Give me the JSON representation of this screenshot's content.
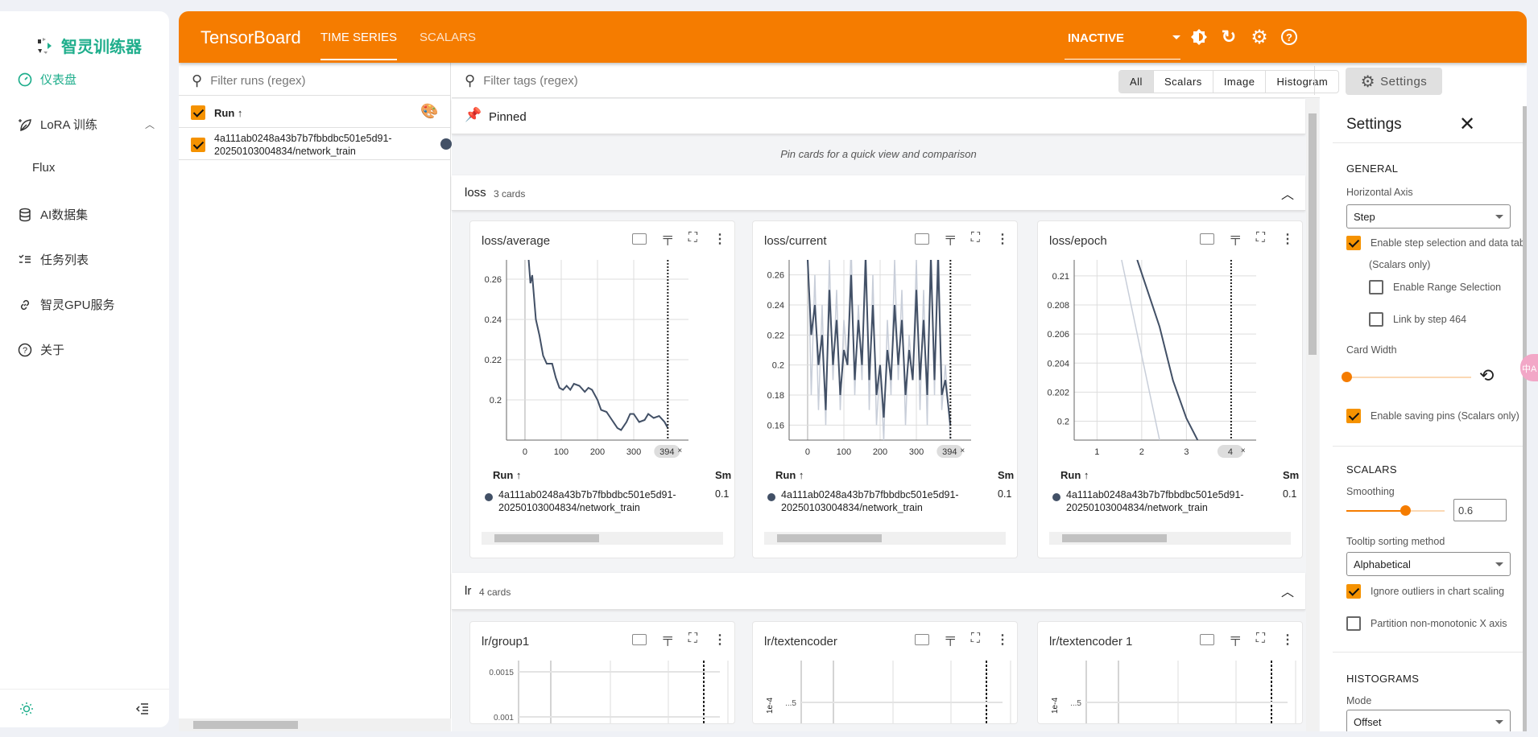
{
  "sidebar": {
    "logo_text": "智灵训练器",
    "items": [
      {
        "label": "仪表盘",
        "icon": "dashboard-icon",
        "active": true
      },
      {
        "label": "LoRA 训练",
        "icon": "leaf-sparkle-icon"
      },
      {
        "label": "Flux"
      },
      {
        "label": "AI数据集",
        "icon": "database-icon"
      },
      {
        "label": "任务列表",
        "icon": "task-list-icon"
      },
      {
        "label": "智灵GPU服务",
        "icon": "link-icon"
      },
      {
        "label": "关于",
        "icon": "help-circle-icon"
      }
    ]
  },
  "header": {
    "brand": "TensorBoard",
    "tabs": [
      "TIME SERIES",
      "SCALARS"
    ],
    "active_tab": "TIME SERIES",
    "plugin_select": "INACTIVE"
  },
  "runs": {
    "filter_placeholder": "Filter runs (regex)",
    "col_header": "Run ↑",
    "items": [
      {
        "name_line1": "4a111ab0248a43b7b7fbbdbc501e5d91-",
        "name_line2": "20250103004834/network_train",
        "checked": true,
        "color": "#425066"
      }
    ]
  },
  "tags": {
    "filter_placeholder": "Filter tags (regex)",
    "toggles": [
      "All",
      "Scalars",
      "Image",
      "Histogram"
    ],
    "active_toggle": "All",
    "settings_button": "Settings"
  },
  "pinned": {
    "title": "Pinned",
    "empty_message": "Pin cards for a quick view and comparison"
  },
  "groups": [
    {
      "name": "loss",
      "count": "3 cards"
    },
    {
      "name": "lr",
      "count": "4 cards"
    }
  ],
  "legend": {
    "run_header": "Run ↑",
    "smoothed_header": "Sm",
    "value": "0.1"
  },
  "chart_data": [
    {
      "type": "line",
      "title": "loss/average",
      "xlim": [
        -51,
        451
      ],
      "ylim": [
        0.18,
        0.2696
      ],
      "xticks": [
        "0",
        "100",
        "200",
        "300"
      ],
      "yticks": [
        "0.2",
        "0.22",
        "0.24",
        "0.26"
      ],
      "step_marker": "394",
      "grid": true,
      "series": [
        {
          "x": [
            10,
            15,
            20,
            30,
            40,
            50,
            60,
            75,
            85,
            95,
            105,
            115,
            125,
            135,
            150,
            165,
            175,
            185,
            200,
            210,
            225,
            240,
            255,
            265,
            280,
            290,
            300,
            315,
            330,
            340,
            355,
            370,
            385,
            394
          ],
          "y": [
            0.27,
            0.258,
            0.262,
            0.24,
            0.232,
            0.222,
            0.218,
            0.218,
            0.211,
            0.206,
            0.205,
            0.207,
            0.205,
            0.208,
            0.207,
            0.204,
            0.206,
            0.205,
            0.2,
            0.195,
            0.194,
            0.19,
            0.186,
            0.185,
            0.189,
            0.193,
            0.193,
            0.189,
            0.19,
            0.193,
            0.191,
            0.192,
            0.189,
            0.186
          ]
        }
      ]
    },
    {
      "type": "line",
      "title": "loss/current",
      "xlim": [
        -51,
        451
      ],
      "ylim": [
        0.15,
        0.27
      ],
      "xticks": [
        "0",
        "100",
        "200",
        "300"
      ],
      "yticks": [
        "0.16",
        "0.18",
        "0.2",
        "0.22",
        "0.24",
        "0.26"
      ],
      "step_marker": "394",
      "grid": true,
      "series": [
        {
          "name": "raw",
          "x": [
            0,
            10,
            20,
            30,
            40,
            50,
            60,
            70,
            80,
            90,
            100,
            110,
            120,
            130,
            140,
            150,
            160,
            170,
            180,
            190,
            200,
            210,
            220,
            230,
            240,
            250,
            260,
            270,
            280,
            290,
            300,
            310,
            320,
            330,
            340,
            350,
            360,
            370,
            380,
            394
          ],
          "y": [
            0.29,
            0.18,
            0.26,
            0.17,
            0.24,
            0.16,
            0.27,
            0.19,
            0.25,
            0.17,
            0.23,
            0.2,
            0.28,
            0.18,
            0.24,
            0.19,
            0.29,
            0.17,
            0.26,
            0.16,
            0.2,
            0.15,
            0.23,
            0.18,
            0.27,
            0.19,
            0.25,
            0.16,
            0.22,
            0.19,
            0.27,
            0.17,
            0.25,
            0.16,
            0.29,
            0.18,
            0.3,
            0.17,
            0.2,
            0.15
          ]
        },
        {
          "name": "smoothed",
          "x": [
            0,
            10,
            20,
            30,
            40,
            50,
            60,
            70,
            80,
            90,
            100,
            110,
            120,
            130,
            140,
            150,
            160,
            170,
            180,
            190,
            200,
            210,
            220,
            230,
            240,
            250,
            260,
            270,
            280,
            290,
            300,
            310,
            320,
            330,
            340,
            350,
            360,
            370,
            380,
            394
          ],
          "y": [
            0.27,
            0.22,
            0.24,
            0.2,
            0.22,
            0.17,
            0.25,
            0.2,
            0.23,
            0.18,
            0.21,
            0.2,
            0.26,
            0.19,
            0.23,
            0.2,
            0.27,
            0.19,
            0.24,
            0.18,
            0.2,
            0.165,
            0.21,
            0.19,
            0.24,
            0.2,
            0.23,
            0.18,
            0.21,
            0.19,
            0.25,
            0.19,
            0.23,
            0.18,
            0.27,
            0.19,
            0.27,
            0.18,
            0.19,
            0.16
          ]
        }
      ]
    },
    {
      "type": "line",
      "title": "loss/epoch",
      "xlim": [
        0.49,
        4.56
      ],
      "ylim": [
        0.1987,
        0.2111
      ],
      "xticks": [
        "1",
        "2",
        "3"
      ],
      "yticks": [
        "0.2",
        "0.202",
        "0.204",
        "0.206",
        "0.208",
        "0.21"
      ],
      "step_marker": "4",
      "grid": true,
      "series": [
        {
          "name": "raw",
          "x": [
            1.55,
            2.4
          ],
          "y": [
            0.2111,
            0.1987
          ]
        },
        {
          "name": "smoothed",
          "x": [
            1.9,
            2.4,
            2.7,
            3.0,
            3.25
          ],
          "y": [
            0.2111,
            0.2065,
            0.2028,
            0.2002,
            0.1987
          ]
        }
      ]
    },
    {
      "type": "line",
      "title": "lr/group1",
      "yticks": [
        "0.001",
        "0.0015"
      ],
      "grid": true
    },
    {
      "type": "line",
      "title": "lr/textencoder",
      "yticks": [
        "...5"
      ],
      "ylabel": "1e-4",
      "grid": true
    },
    {
      "type": "line",
      "title": "lr/textencoder 1",
      "yticks": [
        "...5"
      ],
      "ylabel": "1e-4",
      "grid": true
    }
  ],
  "settings": {
    "title": "Settings",
    "general": {
      "heading": "GENERAL",
      "horizontal_axis_label": "Horizontal Axis",
      "horizontal_axis": "Step",
      "step_selection": "Enable step selection and data table",
      "step_selection_sub": "(Scalars only)",
      "range_selection": "Enable Range Selection",
      "link_by_step": "Link by step 464",
      "card_width_label": "Card Width",
      "card_width": 0,
      "saving_pins": "Enable saving pins (Scalars only)"
    },
    "scalars": {
      "heading": "SCALARS",
      "smoothing_label": "Smoothing",
      "smoothing": 0.6,
      "smoothing_text": "0.6",
      "tooltip_label": "Tooltip sorting method",
      "tooltip_sort": "Alphabetical",
      "ignore_outliers": "Ignore outliers in chart scaling",
      "partition": "Partition non-monotonic X axis"
    },
    "histograms": {
      "heading": "HISTOGRAMS",
      "mode_label": "Mode",
      "mode": "Offset"
    }
  },
  "colors": {
    "accent": "#f57c00",
    "brand_teal": "#1fae8c",
    "series": "#425066",
    "series_raw": "#c8ced9"
  }
}
